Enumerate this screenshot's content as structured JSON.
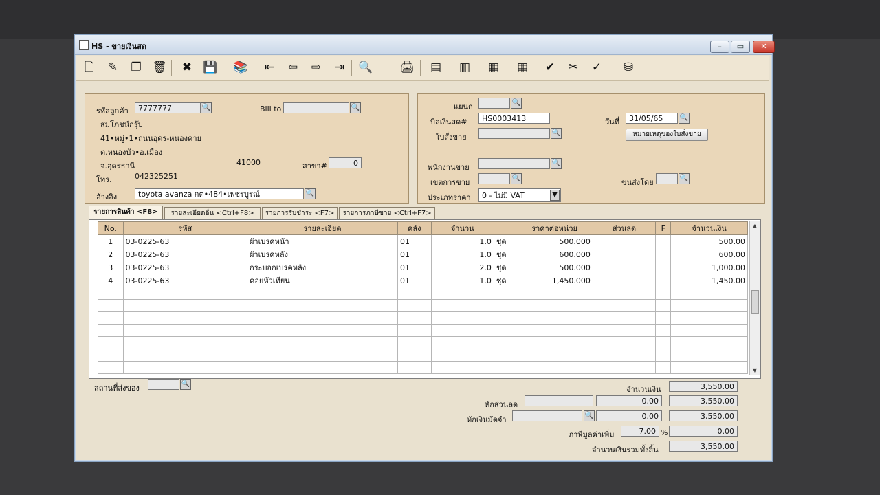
{
  "window": {
    "title": "HS - ขายเงินสด",
    "min": "–",
    "max": "▭",
    "close": "✕"
  },
  "toolbar": [
    {
      "name": "new-icon",
      "glyph": "🗋"
    },
    {
      "name": "edit-icon",
      "glyph": "✎"
    },
    {
      "name": "copy-icon",
      "glyph": "❐"
    },
    {
      "name": "delete-icon",
      "glyph": "🗑"
    },
    {
      "name": "cancel-icon",
      "glyph": "✖"
    },
    {
      "name": "save-icon",
      "glyph": "💾"
    },
    {
      "name": "records-icon",
      "glyph": "📚"
    },
    {
      "name": "first-record-icon",
      "glyph": "⇤"
    },
    {
      "name": "previous-record-icon",
      "glyph": "⇦"
    },
    {
      "name": "next-record-icon",
      "glyph": "⇨"
    },
    {
      "name": "last-record-icon",
      "glyph": "⇥"
    },
    {
      "name": "search-icon",
      "glyph": "🔍"
    },
    {
      "name": "print-icon",
      "glyph": "🖨"
    },
    {
      "name": "export-icon",
      "glyph": "▤"
    },
    {
      "name": "report-icon",
      "glyph": "▥"
    },
    {
      "name": "chart-icon",
      "glyph": "▦"
    },
    {
      "name": "calendar-icon",
      "glyph": "▦"
    },
    {
      "name": "approve-icon",
      "glyph": "✔"
    },
    {
      "name": "tools-icon",
      "glyph": "✂"
    },
    {
      "name": "ok-icon",
      "glyph": "✓"
    },
    {
      "name": "database-icon",
      "glyph": "⛁"
    }
  ],
  "customer": {
    "code_label": "รหัสลูกค้า",
    "code": "7777777",
    "bill_to_label": "Bill to",
    "bill_to": "",
    "name": "สมโภชน์กรุ๊ป",
    "address1": "41•หมู่•1•ถนนอุดร-หนองคาย",
    "address2": "ต.หนองบัว•อ.เมือง",
    "address3": "จ.อุดรธานี",
    "postcode": "41000",
    "branch_label": "สาขา#",
    "branch": "0",
    "phone_label": "โทร.",
    "phone": "042325251",
    "ref_label": "อ้างอิง",
    "ref": "toyota avanza กต•484•เพชรบูรณ์"
  },
  "document": {
    "dept_label": "แผนก",
    "dept": "",
    "bill_no_label": "บิลเงินสด#",
    "bill_no": "HS0003413",
    "date_label": "วันที่",
    "date": "31/05/65",
    "so_label": "ใบสั่งขาย",
    "so": "",
    "so_note_button": "หมายเหตุของใบสั่งขาย",
    "salesperson_label": "พนักงานขาย",
    "salesperson": "",
    "area_label": "เขตการขาย",
    "area": "",
    "ship_by_label": "ขนส่งโดย",
    "ship_by": "",
    "price_type_label": "ประเภทราคา",
    "price_type": "0 - ไม่มี VAT"
  },
  "tabs": [
    "รายการสินค้า <F8>",
    "รายละเอียดอื่น <Ctrl+F8>",
    "รายการรับชำระ <F7>",
    "รายการภาษีขาย <Ctrl+F7>"
  ],
  "table": {
    "headers": [
      "No.",
      "รหัส",
      "รายละเอียด",
      "คลัง",
      "จำนวน",
      "",
      "ราคาต่อหน่วย",
      "ส่วนลด",
      "F",
      "จำนวนเงิน"
    ],
    "rows": [
      [
        "1",
        "03-0225-63",
        "ผ้าเบรคหน้า",
        "01",
        "1.0",
        "ชุด",
        "500.000",
        "",
        "",
        "500.00"
      ],
      [
        "2",
        "03-0225-63",
        "ผ้าเบรคหลัง",
        "01",
        "1.0",
        "ชุด",
        "600.000",
        "",
        "",
        "600.00"
      ],
      [
        "3",
        "03-0225-63",
        "กระบอกเบรคหลัง",
        "01",
        "2.0",
        "ชุด",
        "500.000",
        "",
        "",
        "1,000.00"
      ],
      [
        "4",
        "03-0225-63",
        "คอยหัวเทียน",
        "01",
        "1.0",
        "ชุด",
        "1,450.000",
        "",
        "",
        "1,450.00"
      ]
    ]
  },
  "footer": {
    "ship_to_label": "สถานที่ส่งของ",
    "ship_to": "",
    "amount_label": "จำนวนเงิน",
    "amount": "3,550.00",
    "discount_label": "หักส่วนลด",
    "discount_input": "",
    "discount_value": "0.00",
    "discount_total": "3,550.00",
    "deposit_label": "หักเงินมัดจำ",
    "deposit_input": "",
    "deposit_value": "0.00",
    "deposit_total": "3,550.00",
    "vat_label": "ภาษีมูลค่าเพิ่ม",
    "vat_rate": "7.00",
    "vat_pct": "%",
    "vat_amount": "0.00",
    "grand_total_label": "จำนวนเงินรวมทั้งสิ้น",
    "grand_total": "3,550.00"
  }
}
